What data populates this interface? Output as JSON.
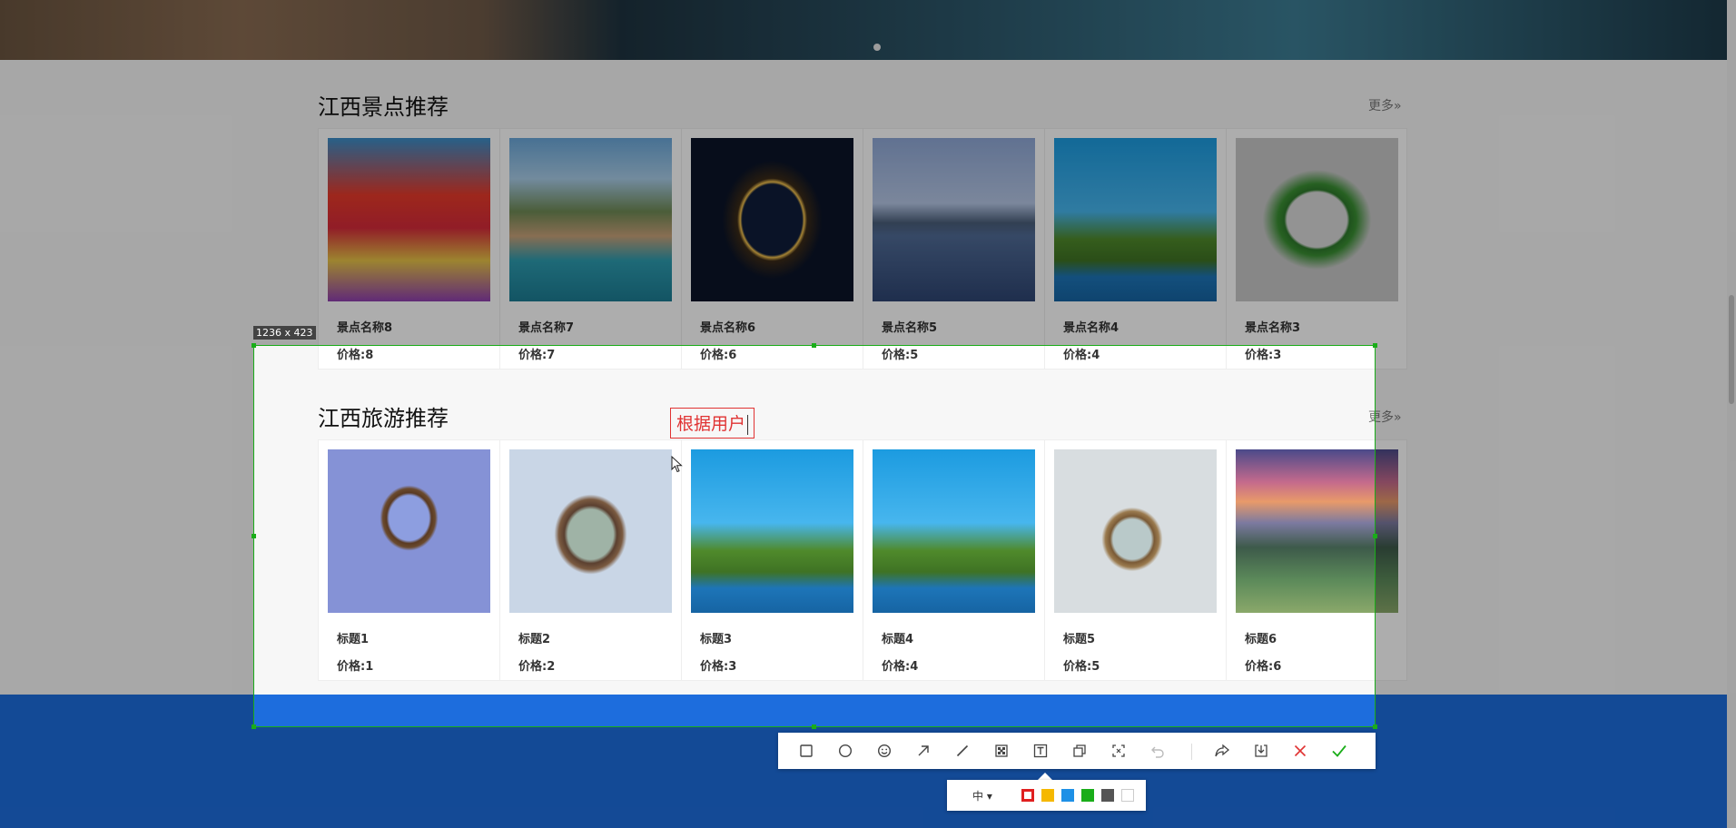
{
  "section1": {
    "title": "江西景点推荐",
    "more": "更多»",
    "items": [
      {
        "name": "景点名称8",
        "price": "价格:8"
      },
      {
        "name": "景点名称7",
        "price": "价格:7"
      },
      {
        "name": "景点名称6",
        "price": "价格:6"
      },
      {
        "name": "景点名称5",
        "price": "价格:5"
      },
      {
        "name": "景点名称4",
        "price": "价格:4"
      },
      {
        "name": "景点名称3",
        "price": "价格:3"
      }
    ]
  },
  "section2": {
    "title": "江西旅游推荐",
    "more": "更多»",
    "items": [
      {
        "name": "标题1",
        "price": "价格:1"
      },
      {
        "name": "标题2",
        "price": "价格:2"
      },
      {
        "name": "标题3",
        "price": "价格:3"
      },
      {
        "name": "标题4",
        "price": "价格:4"
      },
      {
        "name": "标题5",
        "price": "价格:5"
      },
      {
        "name": "标题6",
        "price": "价格:6"
      }
    ]
  },
  "capture": {
    "size_label": "1236 x 423",
    "text_annotation": "根据用户",
    "selection_color": "#1aad19",
    "annotation_color": "#e03333"
  },
  "toolbar": {
    "tools": [
      "rectangle-icon",
      "ellipse-icon",
      "emoji-icon",
      "arrow-icon",
      "line-icon",
      "mosaic-icon",
      "text-icon",
      "pin-icon",
      "ocr-icon",
      "undo-icon",
      "share-icon",
      "save-icon",
      "cancel-icon",
      "confirm-icon"
    ],
    "font_size": "中 ▾",
    "colors": [
      "#e02020",
      "#f5b800",
      "#1e90e6",
      "#1aad19",
      "#555555",
      "#ffffff"
    ],
    "selected_color": "#e02020"
  },
  "footer_color": "#1d6ddd"
}
